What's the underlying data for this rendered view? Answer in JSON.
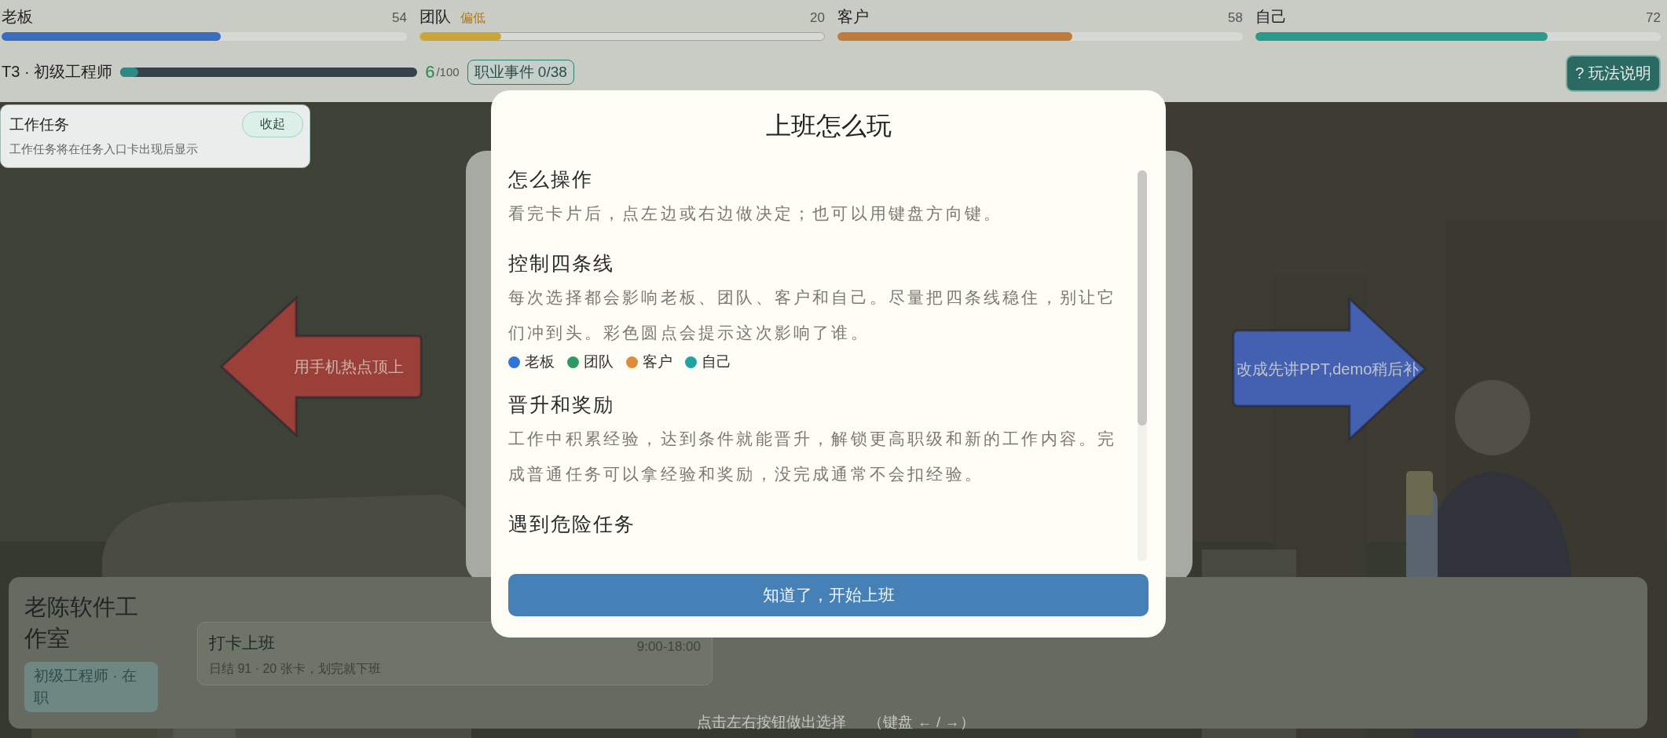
{
  "meters": [
    {
      "label": "老板",
      "value": "54",
      "level": 0.54,
      "color": "#3a6cc0",
      "warning": false
    },
    {
      "label": "团队",
      "tag": "偏低",
      "value": "20",
      "level": 0.2,
      "color": "#c9a437",
      "warning": true
    },
    {
      "label": "客户",
      "value": "58",
      "level": 0.58,
      "color": "#c07a3a",
      "warning": false
    },
    {
      "label": "自己",
      "value": "72",
      "level": 0.72,
      "color": "#2a9a8a",
      "warning": false
    }
  ],
  "career": {
    "rank": "T3 · 初级工程师",
    "level": 0.06,
    "exp": "6",
    "exp_total": "/100",
    "events": "职业事件 0/38"
  },
  "help_button": "? 玩法说明",
  "task_panel": {
    "title": "工作任务",
    "collapse_button": "收起",
    "message": "工作任务将在任务入口卡出现后显示"
  },
  "choices": [
    {
      "kind": "left",
      "label": "用手机热点顶上",
      "color": "#9a4038"
    },
    {
      "kind": "right",
      "label": "改成先讲PPT,demo稍后补",
      "color": "#4460b0"
    }
  ],
  "company": {
    "name": "老陈软件工作室",
    "role": "初级工程师 · 在职"
  },
  "shift": {
    "title": "打卡上班",
    "detail": "日结 91 · 20 张卡，划完就下班",
    "hours": "9:00-18:00"
  },
  "hint": {
    "text": "点击左右按钮做出选择",
    "keys": "（键盘 ← / →）"
  },
  "modal": {
    "title": "上班怎么玩",
    "sections": [
      {
        "heading": "怎么操作",
        "paragraph": "看完卡片后，点左边或右边做决定；也可以用键盘方向键。"
      },
      {
        "heading": "控制四条线",
        "paragraph": "每次选择都会影响老板、团队、客户和自己。尽量把四条线稳住，别让它们冲到头。彩色圆点会提示这次影响了谁。",
        "legend": [
          {
            "label": "老板",
            "color": "#2f74d8"
          },
          {
            "label": "团队",
            "color": "#2e9a62"
          },
          {
            "label": "客户",
            "color": "#e08a3c"
          },
          {
            "label": "自己",
            "color": "#22a3a0"
          }
        ]
      },
      {
        "heading": "晋升和奖励",
        "paragraph": "工作中积累经验，达到条件就能晋升，解锁更高职级和新的工作内容。完成普通任务可以拿经验和奖励，没完成通常不会扣经验。"
      },
      {
        "heading": "遇到危险任务"
      }
    ],
    "button": "知道了，开始上班"
  }
}
